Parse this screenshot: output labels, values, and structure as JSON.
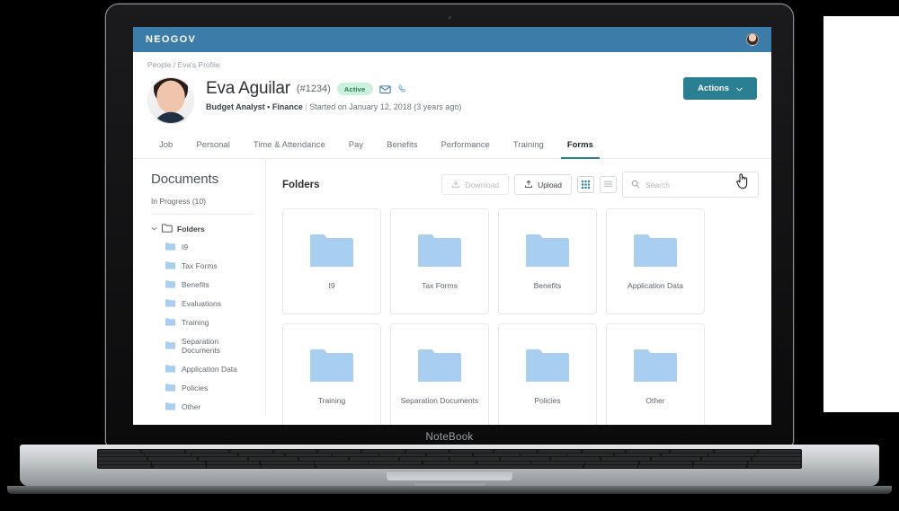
{
  "device": {
    "bezel_label": "NoteBook"
  },
  "topbar": {
    "brand": "NEOGOV",
    "avatar_icon": "user-avatar-icon"
  },
  "breadcrumb": {
    "text": "People / Eva's Profile"
  },
  "profile": {
    "photo_icon": "profile-photo",
    "name": "Eva Aguilar",
    "employee_id": "(#1234)",
    "status": "Active",
    "email_icon": "envelope-icon",
    "phone_icon": "phone-icon",
    "job_title": "Budget Analyst • Finance",
    "divider": "|",
    "start_info": "Started on January 12, 2018 (3 years ago)",
    "actions_label": "Actions",
    "actions_chevron_icon": "chevron-down-icon"
  },
  "tabs": [
    {
      "label": "Job",
      "active": false
    },
    {
      "label": "Personal",
      "active": false
    },
    {
      "label": "Time & Attendance",
      "active": false
    },
    {
      "label": "Pay",
      "active": false
    },
    {
      "label": "Benefits",
      "active": false
    },
    {
      "label": "Performance",
      "active": false
    },
    {
      "label": "Training",
      "active": false
    },
    {
      "label": "Forms",
      "active": true
    }
  ],
  "sidebar": {
    "title": "Documents",
    "in_progress": "In Progress (10)",
    "tree_root": "Folders",
    "tree_chevron_icon": "chevron-down-icon",
    "tree_root_icon": "folder-outline-icon",
    "items": [
      {
        "label": "I9"
      },
      {
        "label": "Tax Forms"
      },
      {
        "label": "Benefits"
      },
      {
        "label": "Evaluations"
      },
      {
        "label": "Training"
      },
      {
        "label": "Separation Documents"
      },
      {
        "label": "Application Data"
      },
      {
        "label": "Policies"
      },
      {
        "label": "Other"
      }
    ]
  },
  "main": {
    "heading": "Folders",
    "download_label": "Download",
    "download_icon": "download-icon",
    "upload_label": "Upload",
    "upload_icon": "upload-icon",
    "grid_view_icon": "grid-view-icon",
    "list_view_icon": "list-view-icon",
    "search_icon": "search-icon",
    "search_placeholder": "Search",
    "search_value": "",
    "folders": [
      {
        "name": "I9"
      },
      {
        "name": "Tax Forms"
      },
      {
        "name": "Benefits"
      },
      {
        "name": "Application Data"
      },
      {
        "name": "Training"
      },
      {
        "name": "Separation Documents"
      },
      {
        "name": "Policies"
      },
      {
        "name": "Other"
      }
    ]
  },
  "colors": {
    "topbar_blue": "#3b7ca8",
    "accent_teal": "#2a7f92",
    "badge_green_bg": "#c9f1dc",
    "badge_green_text": "#2f7a55",
    "folder_blue": "#a8cff2"
  }
}
